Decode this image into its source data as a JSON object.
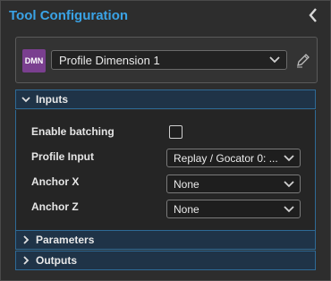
{
  "panel": {
    "title": "Tool Configuration"
  },
  "tool": {
    "badge": "DMN",
    "name": "Profile Dimension 1"
  },
  "sections": {
    "inputs": "Inputs",
    "parameters": "Parameters",
    "outputs": "Outputs"
  },
  "inputs": {
    "enable_batching_label": "Enable batching",
    "enable_batching_checked": false,
    "profile_input_label": "Profile Input",
    "profile_input_value": "Replay / Gocator 0: ...",
    "anchor_x_label": "Anchor X",
    "anchor_x_value": "None",
    "anchor_z_label": "Anchor Z",
    "anchor_z_value": "None"
  },
  "colors": {
    "accent": "#3aa3e6",
    "section_header_bg": "#1f3347",
    "section_border": "#2e6a96",
    "badge": "#7a3f8f"
  },
  "icons": [
    "chevron-left-icon",
    "chevron-down-icon",
    "pencil-icon",
    "chevron-right-icon"
  ]
}
